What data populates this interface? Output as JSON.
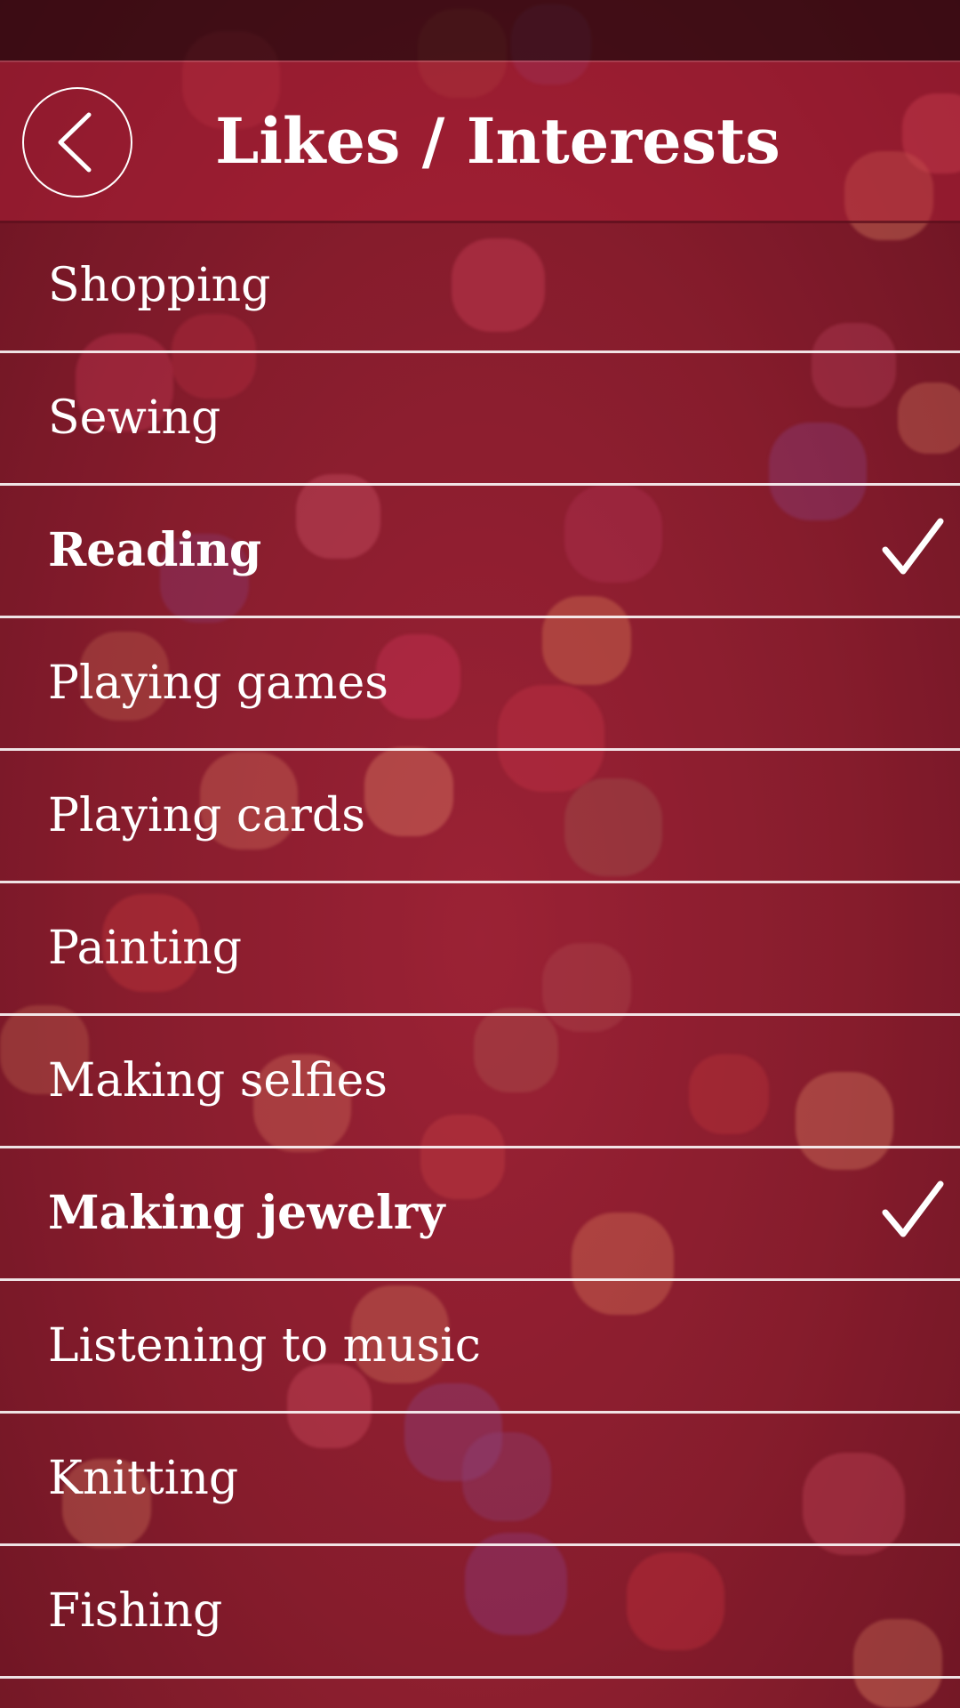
{
  "header": {
    "title": "Likes / Interests",
    "back_icon": "chevron-left-icon"
  },
  "interests": [
    {
      "label": "Shopping",
      "selected": false
    },
    {
      "label": "Sewing",
      "selected": false
    },
    {
      "label": "Reading",
      "selected": true
    },
    {
      "label": "Playing games",
      "selected": false
    },
    {
      "label": "Playing cards",
      "selected": false
    },
    {
      "label": "Painting",
      "selected": false
    },
    {
      "label": "Making selfies",
      "selected": false
    },
    {
      "label": "Making jewelry",
      "selected": true
    },
    {
      "label": "Listening to music",
      "selected": false
    },
    {
      "label": "Knitting",
      "selected": false
    },
    {
      "label": "Fishing",
      "selected": false
    }
  ],
  "colors": {
    "background": "#8f1f2e",
    "header": "#aa1e34",
    "text": "#ffffff",
    "divider": "#ffffff"
  },
  "check_icon": "checkmark-icon"
}
